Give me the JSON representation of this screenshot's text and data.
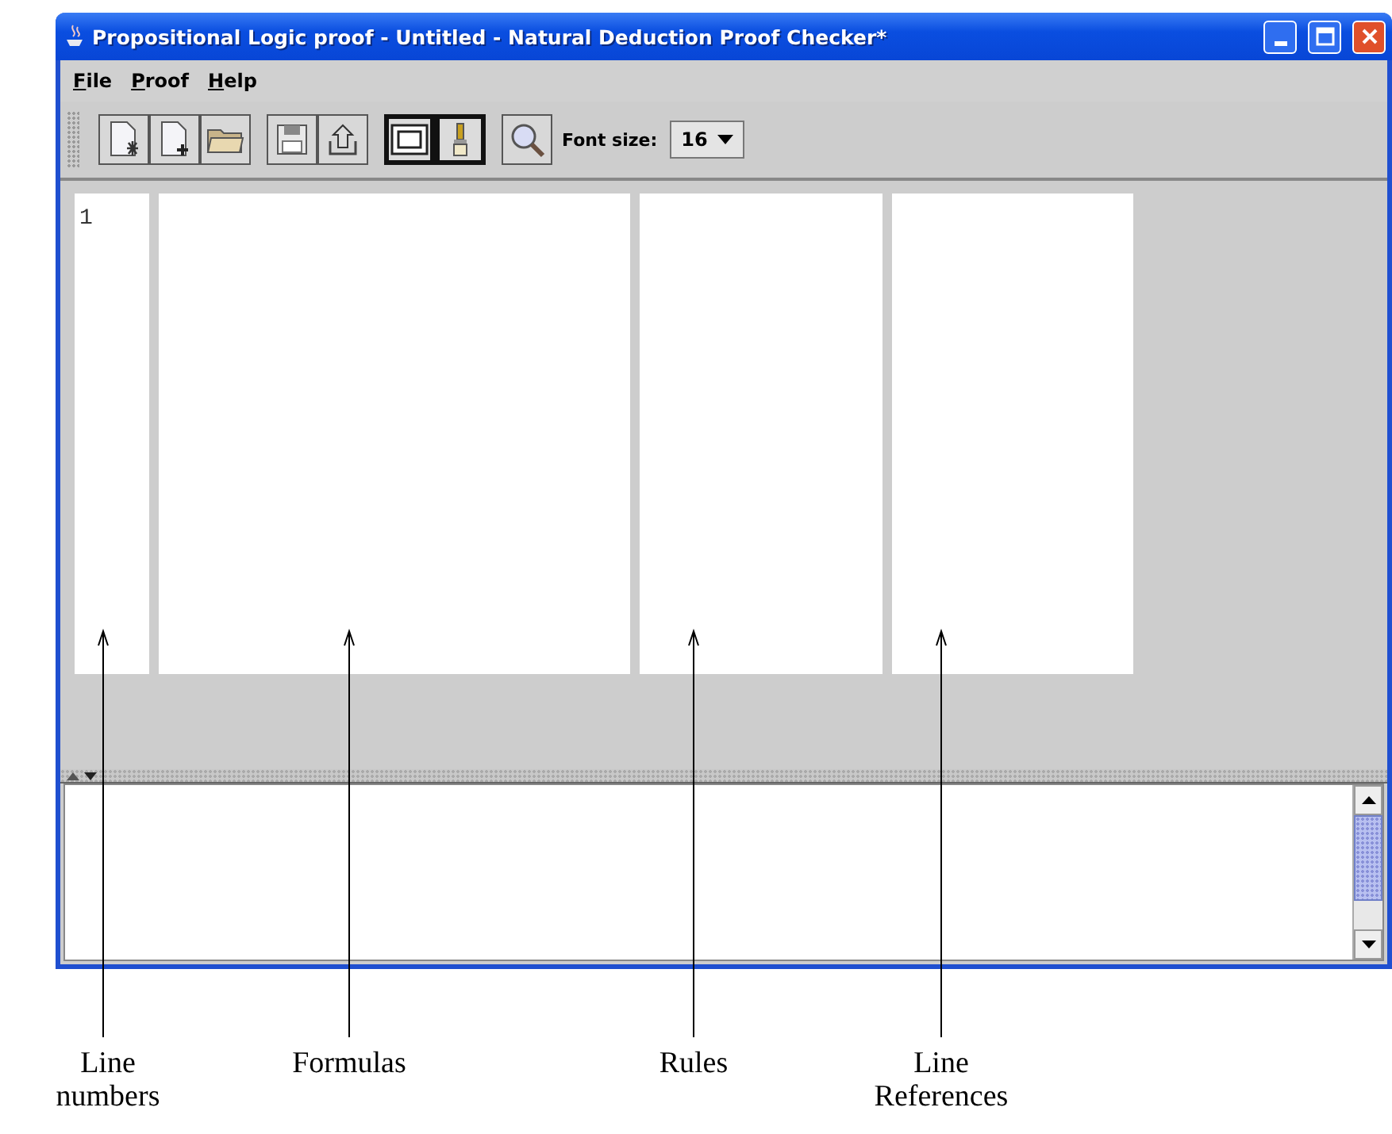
{
  "window": {
    "title": "Propositional Logic proof - Untitled - Natural Deduction Proof Checker*"
  },
  "menu": [
    {
      "label": "File"
    },
    {
      "label": "Proof"
    },
    {
      "label": "Help"
    }
  ],
  "toolbar": {
    "buttons": [
      {
        "kind": "new",
        "pressed": false
      },
      {
        "kind": "add",
        "pressed": false
      },
      {
        "kind": "open",
        "pressed": false
      },
      {
        "kind": "save",
        "pressed": false
      },
      {
        "kind": "export",
        "pressed": false
      },
      {
        "kind": "frame",
        "pressed": true
      },
      {
        "kind": "brush",
        "pressed": true
      },
      {
        "kind": "zoom",
        "pressed": false
      }
    ],
    "font_size": {
      "label": "Font size:",
      "value": "16"
    }
  },
  "proof": {
    "line_numbers": [
      "1"
    ]
  },
  "annotations": [
    {
      "label": "Line numbers"
    },
    {
      "label": "Formulas"
    },
    {
      "label": "Rules"
    },
    {
      "label": "Line References"
    }
  ]
}
